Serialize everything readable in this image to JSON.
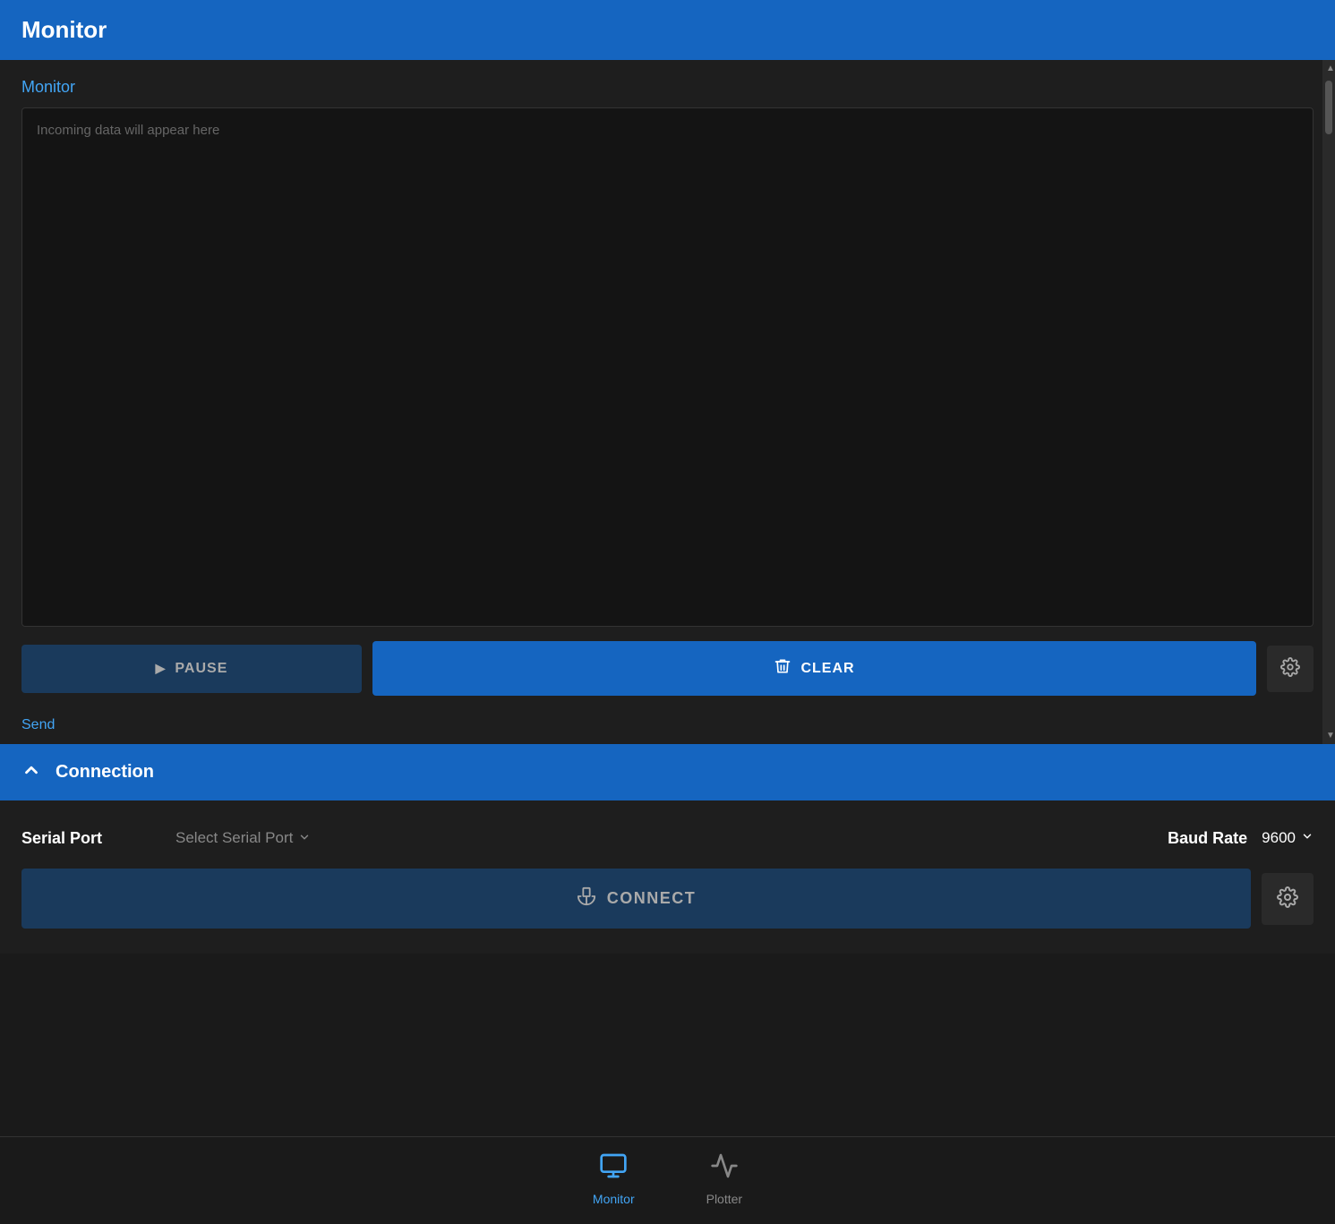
{
  "app": {
    "title": "Monitor"
  },
  "header": {
    "title": "Monitor"
  },
  "monitor_section": {
    "label": "Monitor",
    "data_placeholder": "Incoming data will appear here",
    "pause_label": "PAUSE",
    "clear_label": "CLEAR",
    "send_label": "Send"
  },
  "connection_section": {
    "header_label": "Connection",
    "serial_port_label": "Serial Port",
    "serial_port_placeholder": "Select Serial Port",
    "baud_rate_label": "Baud Rate",
    "baud_rate_value": "9600",
    "connect_label": "CONNECT"
  },
  "bottom_nav": {
    "monitor_label": "Monitor",
    "plotter_label": "Plotter"
  },
  "icons": {
    "gear": "⚙",
    "pause_arrow": "▶",
    "trash": "🗑",
    "connect_plug": "⚡",
    "monitor_icon": "▣",
    "plotter_icon": "∿",
    "chevron_up": "∧",
    "dropdown_arrow": "▾",
    "scroll_up": "▲",
    "scroll_down": "▼"
  }
}
